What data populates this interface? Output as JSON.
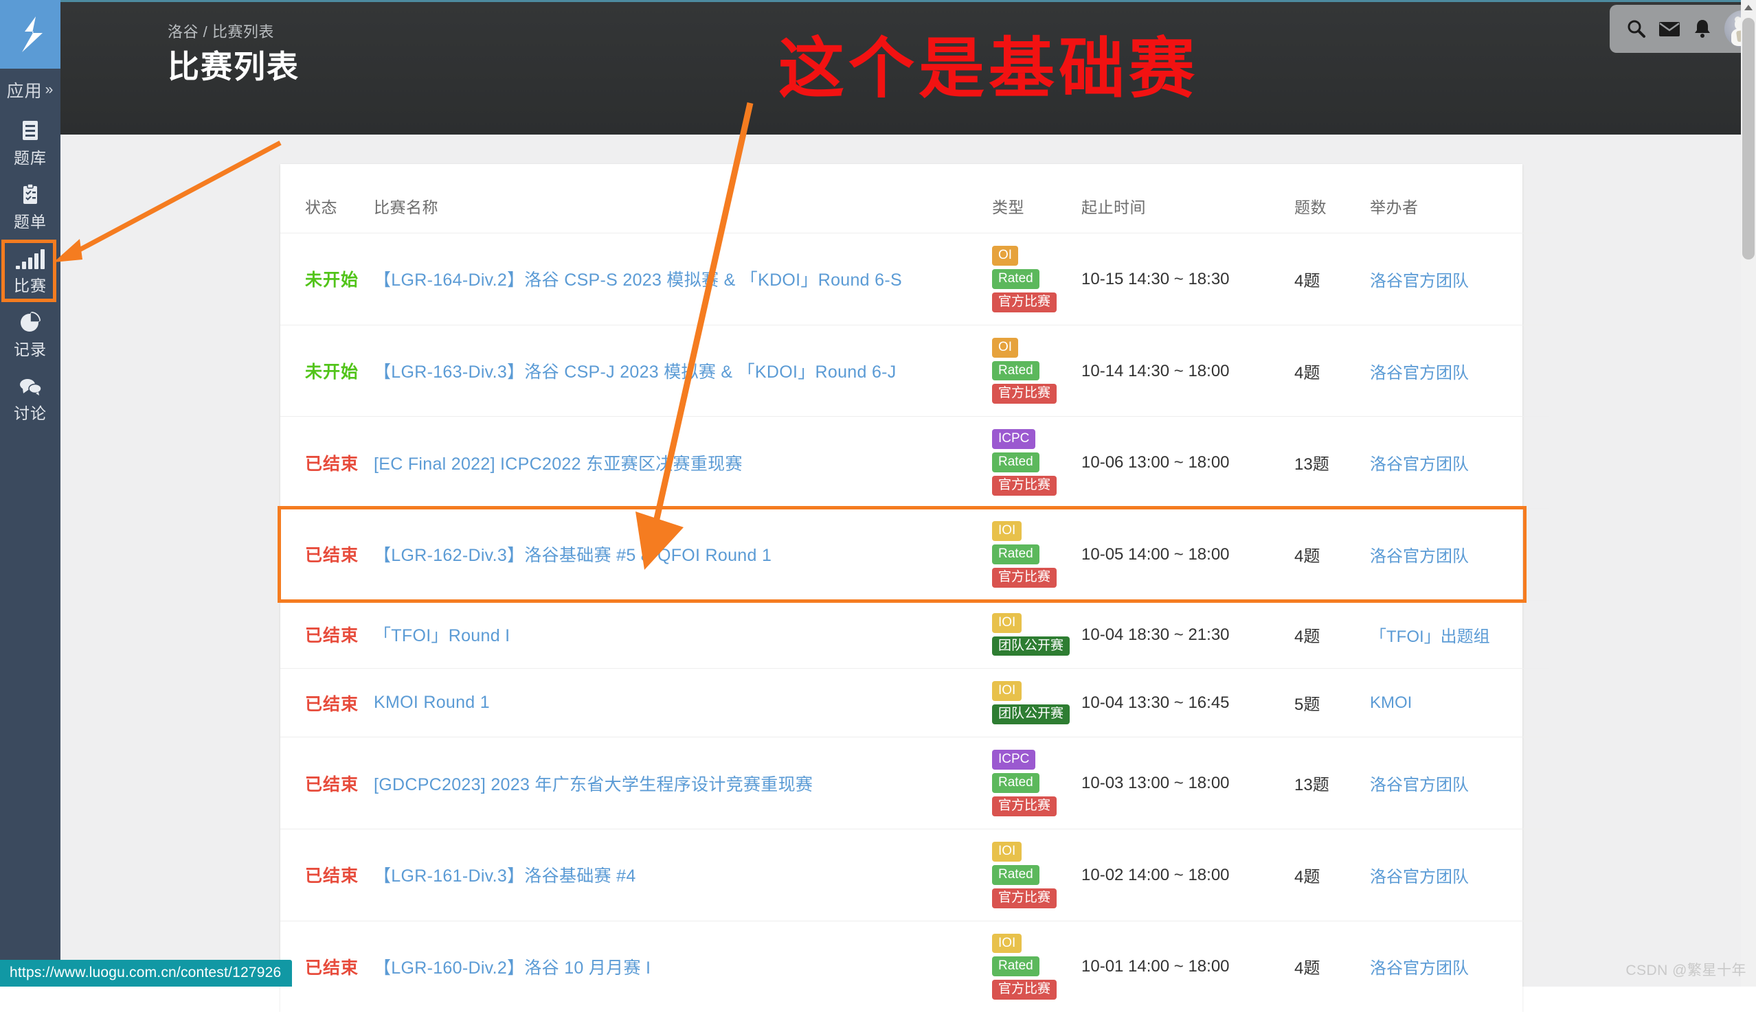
{
  "sidebar": {
    "logo_icon": "luogu-logo-icon",
    "apps_label": "应用",
    "apps_chevron": "»",
    "items": [
      {
        "label": "题库",
        "icon": "book-icon"
      },
      {
        "label": "题单",
        "icon": "clipboard-icon"
      },
      {
        "label": "比赛",
        "icon": "bar-chart-icon",
        "highlighted": true
      },
      {
        "label": "记录",
        "icon": "pie-chart-icon"
      },
      {
        "label": "讨论",
        "icon": "chat-bubble-icon"
      }
    ]
  },
  "header": {
    "breadcrumb": "洛谷 / 比赛列表",
    "title": "比赛列表",
    "icons": [
      {
        "name": "search-icon"
      },
      {
        "name": "mail-icon"
      },
      {
        "name": "bell-icon"
      },
      {
        "name": "avatar"
      }
    ]
  },
  "table": {
    "columns": {
      "status": "状态",
      "name": "比赛名称",
      "type": "类型",
      "time": "起止时间",
      "count": "题数",
      "host": "举办者"
    },
    "rows": [
      {
        "status": "未开始",
        "status_kind": "upcoming",
        "name": "【LGR-164-Div.2】洛谷 CSP-S 2023 模拟赛 & 「KDOI」Round 6-S",
        "badges": [
          {
            "label": "OI",
            "kind": "oi"
          },
          {
            "label": "Rated",
            "kind": "rated"
          },
          {
            "label": "官方比赛",
            "kind": "official"
          }
        ],
        "time": "10-15 14:30 ~ 18:30",
        "count": "4题",
        "host": "洛谷官方团队"
      },
      {
        "status": "未开始",
        "status_kind": "upcoming",
        "name": "【LGR-163-Div.3】洛谷 CSP-J 2023 模拟赛 & 「KDOI」Round 6-J",
        "badges": [
          {
            "label": "OI",
            "kind": "oi"
          },
          {
            "label": "Rated",
            "kind": "rated"
          },
          {
            "label": "官方比赛",
            "kind": "official"
          }
        ],
        "time": "10-14 14:30 ~ 18:00",
        "count": "4题",
        "host": "洛谷官方团队"
      },
      {
        "status": "已结束",
        "status_kind": "ended",
        "name": "[EC Final 2022] ICPC2022 东亚赛区决赛重现赛",
        "badges": [
          {
            "label": "ICPC",
            "kind": "icpc"
          },
          {
            "label": "Rated",
            "kind": "rated"
          },
          {
            "label": "官方比赛",
            "kind": "official"
          }
        ],
        "time": "10-06 13:00 ~ 18:00",
        "count": "13题",
        "host": "洛谷官方团队"
      },
      {
        "status": "已结束",
        "status_kind": "ended",
        "name": "【LGR-162-Div.3】洛谷基础赛 #5 & QFOI Round 1",
        "badges": [
          {
            "label": "IOI",
            "kind": "ioi"
          },
          {
            "label": "Rated",
            "kind": "rated"
          },
          {
            "label": "官方比赛",
            "kind": "official"
          }
        ],
        "time": "10-05 14:00 ~ 18:00",
        "count": "4题",
        "host": "洛谷官方团队",
        "highlighted": true
      },
      {
        "status": "已结束",
        "status_kind": "ended",
        "name": "「TFOI」Round I",
        "badges": [
          {
            "label": "IOI",
            "kind": "ioi"
          },
          {
            "label": "团队公开赛",
            "kind": "teamopen"
          }
        ],
        "time": "10-04 18:30 ~ 21:30",
        "count": "4题",
        "host": "「TFOI」出题组"
      },
      {
        "status": "已结束",
        "status_kind": "ended",
        "name": "KMOI Round 1",
        "badges": [
          {
            "label": "IOI",
            "kind": "ioi"
          },
          {
            "label": "团队公开赛",
            "kind": "teamopen"
          }
        ],
        "time": "10-04 13:30 ~ 16:45",
        "count": "5题",
        "host": "KMOI"
      },
      {
        "status": "已结束",
        "status_kind": "ended",
        "name": "[GDCPC2023] 2023 年广东省大学生程序设计竞赛重现赛",
        "badges": [
          {
            "label": "ICPC",
            "kind": "icpc"
          },
          {
            "label": "Rated",
            "kind": "rated"
          },
          {
            "label": "官方比赛",
            "kind": "official"
          }
        ],
        "time": "10-03 13:00 ~ 18:00",
        "count": "13题",
        "host": "洛谷官方团队"
      },
      {
        "status": "已结束",
        "status_kind": "ended",
        "name": "【LGR-161-Div.3】洛谷基础赛 #4",
        "badges": [
          {
            "label": "IOI",
            "kind": "ioi"
          },
          {
            "label": "Rated",
            "kind": "rated"
          },
          {
            "label": "官方比赛",
            "kind": "official"
          }
        ],
        "time": "10-02 14:00 ~ 18:00",
        "count": "4题",
        "host": "洛谷官方团队"
      },
      {
        "status": "已结束",
        "status_kind": "ended",
        "name": "【LGR-160-Div.2】洛谷 10 月月赛 I",
        "badges": [
          {
            "label": "IOI",
            "kind": "ioi"
          },
          {
            "label": "Rated",
            "kind": "rated"
          },
          {
            "label": "官方比赛",
            "kind": "official"
          }
        ],
        "time": "10-01 14:00 ~ 18:00",
        "count": "4题",
        "host": "洛谷官方团队"
      }
    ]
  },
  "annotation": {
    "text": "这个是基础赛",
    "color": "#f21212",
    "arrow_color": "#f57c20"
  },
  "statusbar": {
    "url": "https://www.luogu.com.cn/contest/127926"
  },
  "watermark": {
    "text": "CSDN @繁星十年"
  }
}
